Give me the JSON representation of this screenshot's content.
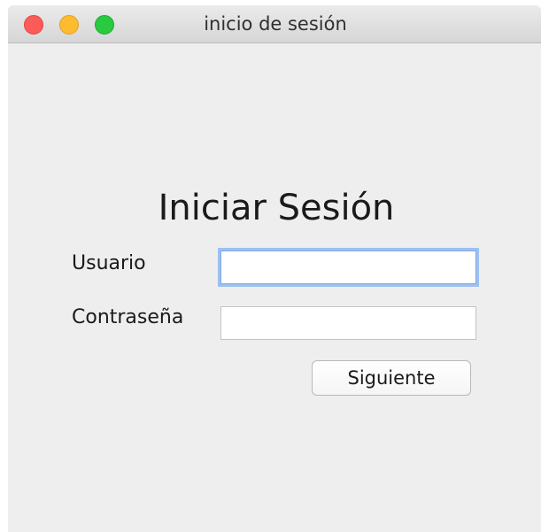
{
  "window": {
    "title": "inicio de sesión"
  },
  "form": {
    "heading": "Iniciar Sesión",
    "username_label": "Usuario",
    "username_value": "",
    "password_label": "Contraseña",
    "password_value": "",
    "submit_label": "Siguiente"
  },
  "colors": {
    "close": "#fc5b57",
    "minimize": "#fdbc2f",
    "zoom": "#29c940",
    "focus_ring": "#9ec0f0",
    "window_bg": "#eeeeee"
  }
}
